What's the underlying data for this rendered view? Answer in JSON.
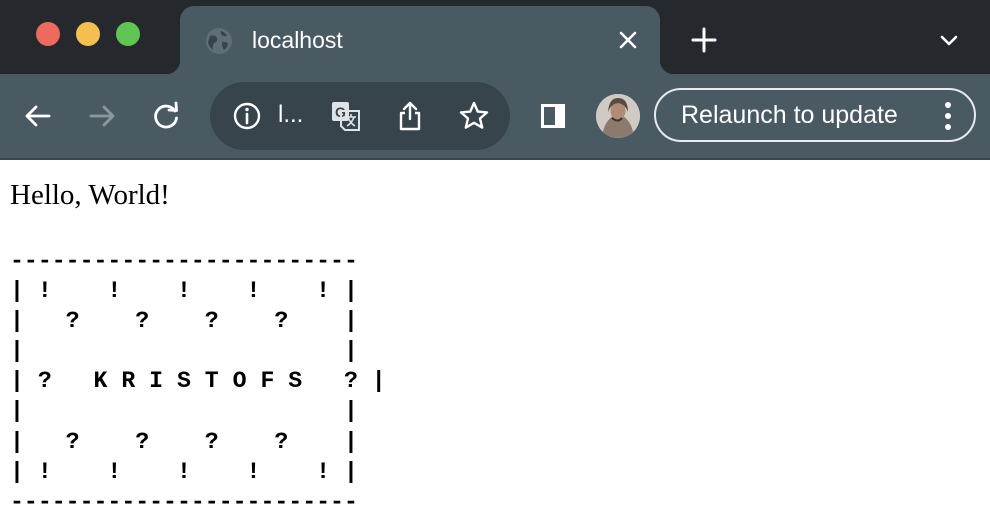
{
  "window": {
    "traffic_lights": [
      {
        "name": "close",
        "color": "#ec6a5e"
      },
      {
        "name": "minimize",
        "color": "#f4bf4f"
      },
      {
        "name": "zoom",
        "color": "#61c554"
      }
    ]
  },
  "tab": {
    "title": "localhost",
    "favicon_icon": "globe-icon",
    "close_icon": "close-icon"
  },
  "tabstrip": {
    "new_tab_icon": "plus-icon",
    "tab_search_icon": "chevron-down-icon"
  },
  "toolbar": {
    "back_icon": "arrow-left-icon",
    "forward_icon": "arrow-right-icon",
    "reload_icon": "reload-icon",
    "site_info_icon": "info-icon",
    "url_text": "l...",
    "translate_icon": "translate-icon",
    "share_icon": "share-icon",
    "bookmark_icon": "star-icon",
    "side_panel_icon": "side-panel-icon",
    "profile_icon": "avatar",
    "relaunch_label": "Relaunch to update",
    "menu_icon": "kebab-menu-icon"
  },
  "page": {
    "heading": "Hello, World!",
    "ascii_lines": [
      "-------------------------",
      "| !    !    !    !    ! |",
      "|   ?    ?    ?    ?    |",
      "|                       |",
      "| ?   K R I S T O F S   ? |",
      "|                       |",
      "|   ?    ?    ?    ?    |",
      "| !    !    !    !    ! |",
      "-------------------------"
    ]
  },
  "colors": {
    "tabstrip_bg": "#25292d",
    "toolbar_bg": "#4a5a63",
    "omnibox_bg": "#38444c",
    "page_bg": "#ffffff"
  }
}
